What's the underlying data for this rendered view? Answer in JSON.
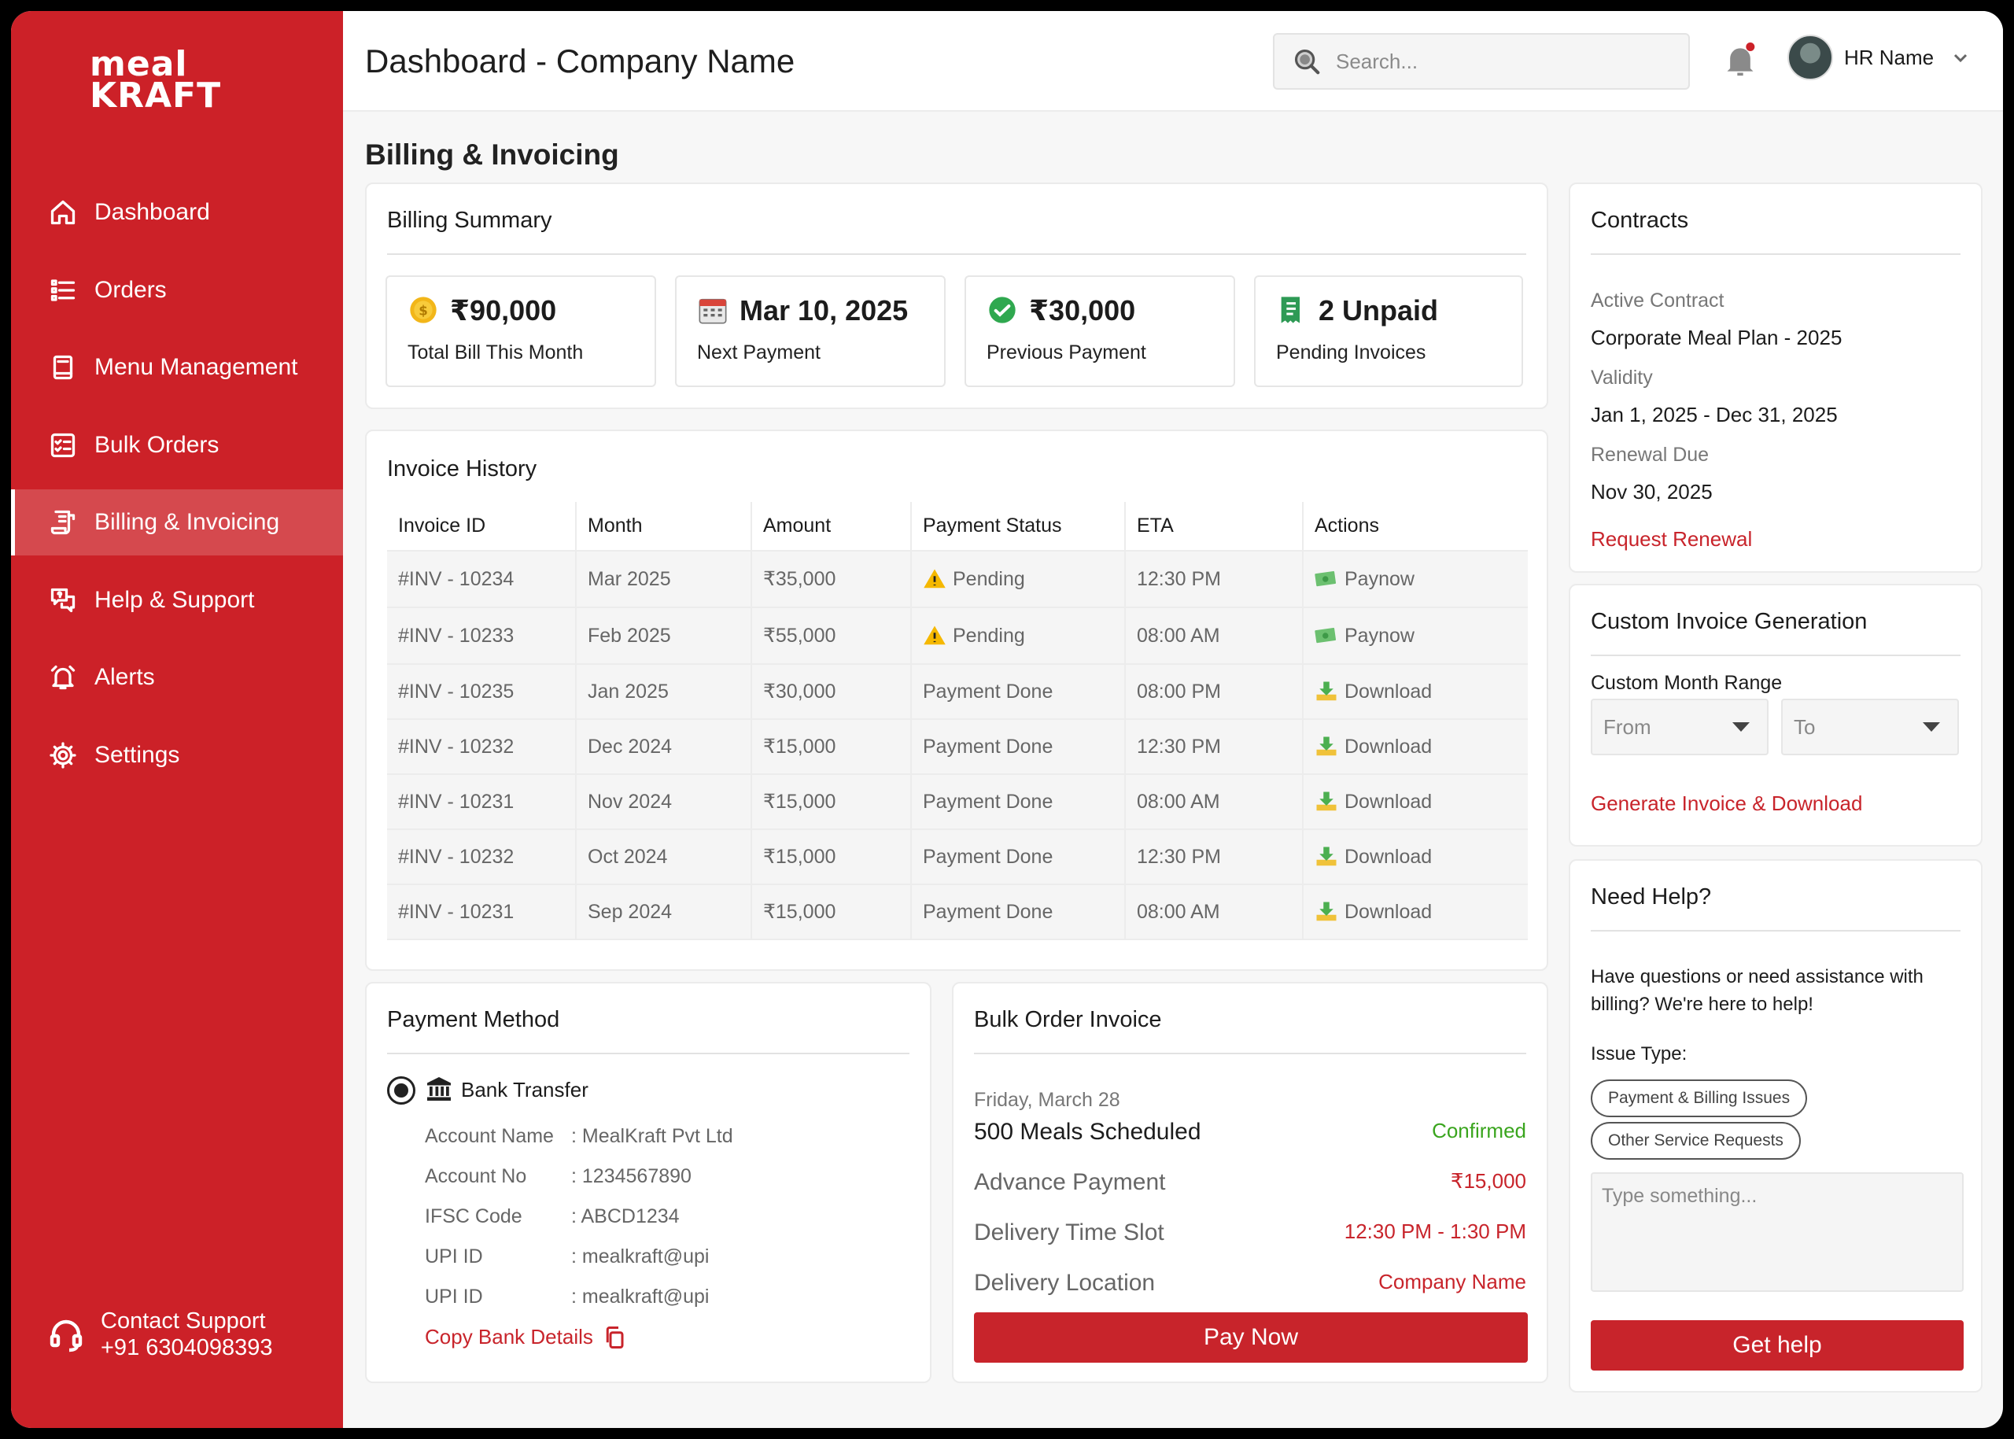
{
  "brand": {
    "logo_line1": "meal",
    "logo_line2": "KRAFT"
  },
  "sidebar": {
    "items": [
      {
        "label": "Dashboard",
        "icon": "home-icon"
      },
      {
        "label": "Orders",
        "icon": "list-icon"
      },
      {
        "label": "Menu Management",
        "icon": "menu-book-icon"
      },
      {
        "label": "Bulk Orders",
        "icon": "checklist-icon"
      },
      {
        "label": "Billing & Invoicing",
        "icon": "invoice-icon",
        "active": true
      },
      {
        "label": "Help & Support",
        "icon": "help-chat-icon"
      },
      {
        "label": "Alerts",
        "icon": "alarm-icon"
      },
      {
        "label": "Settings",
        "icon": "gear-icon"
      }
    ],
    "support": {
      "title": "Contact Support",
      "phone": "+91 6304098393"
    }
  },
  "header": {
    "title": "Dashboard - Company Name",
    "search_placeholder": "Search...",
    "user_name": "HR Name"
  },
  "section_title": "Billing & Invoicing",
  "billing_summary": {
    "title": "Billing Summary",
    "stats": [
      {
        "value": "₹90,000",
        "label": "Total Bill This Month",
        "icon": "coin-icon"
      },
      {
        "value": "Mar 10, 2025",
        "label": "Next Payment",
        "icon": "calendar-icon"
      },
      {
        "value": "₹30,000",
        "label": "Previous Payment",
        "icon": "check-badge-icon"
      },
      {
        "value": "2 Unpaid",
        "label": "Pending Invoices",
        "icon": "receipt-icon"
      }
    ]
  },
  "invoice_history": {
    "title": "Invoice History",
    "columns": [
      "Invoice ID",
      "Month",
      "Amount",
      "Payment Status",
      "ETA",
      "Actions"
    ],
    "rows": [
      {
        "id": "#INV - 10234",
        "month": "Mar 2025",
        "amount": "₹35,000",
        "status": "Pending",
        "eta": "12:30 PM",
        "action": "Paynow"
      },
      {
        "id": "#INV - 10233",
        "month": "Feb 2025",
        "amount": "₹55,000",
        "status": "Pending",
        "eta": "08:00 AM",
        "action": "Paynow"
      },
      {
        "id": "#INV - 10235",
        "month": "Jan 2025",
        "amount": "₹30,000",
        "status": "Payment Done",
        "eta": "08:00 PM",
        "action": "Download"
      },
      {
        "id": "#INV - 10232",
        "month": "Dec 2024",
        "amount": "₹15,000",
        "status": "Payment Done",
        "eta": "12:30 PM",
        "action": "Download"
      },
      {
        "id": "#INV - 10231",
        "month": "Nov 2024",
        "amount": "₹15,000",
        "status": "Payment Done",
        "eta": "08:00 AM",
        "action": "Download"
      },
      {
        "id": "#INV - 10232",
        "month": "Oct 2024",
        "amount": "₹15,000",
        "status": "Payment Done",
        "eta": "12:30 PM",
        "action": "Download"
      },
      {
        "id": "#INV - 10231",
        "month": "Sep 2024",
        "amount": "₹15,000",
        "status": "Payment Done",
        "eta": "08:00 AM",
        "action": "Download"
      }
    ]
  },
  "payment_method": {
    "title": "Payment Method",
    "option": "Bank Transfer",
    "details": [
      {
        "key": "Account Name",
        "value": ": MealKraft Pvt Ltd"
      },
      {
        "key": "Account No",
        "value": ": 1234567890"
      },
      {
        "key": "IFSC Code",
        "value": ": ABCD1234"
      },
      {
        "key": "UPI ID",
        "value": ": mealkraft@upi"
      },
      {
        "key": "UPI ID",
        "value": ": mealkraft@upi"
      }
    ],
    "copy_label": "Copy Bank Details"
  },
  "bulk_invoice": {
    "title": "Bulk Order Invoice",
    "date": "Friday, March 28",
    "meals": "500 Meals Scheduled",
    "status": "Confirmed",
    "advance_label": "Advance Payment",
    "advance_value": "₹15,000",
    "slot_label": "Delivery Time Slot",
    "slot_value": "12:30 PM - 1:30 PM",
    "location_label": "Delivery Location",
    "location_value": "Company Name",
    "pay_button": "Pay Now"
  },
  "contracts": {
    "title": "Contracts",
    "active_label": "Active Contract",
    "active_value": "Corporate Meal Plan - 2025",
    "validity_label": "Validity",
    "validity_value": "Jan 1, 2025 - Dec 31, 2025",
    "renewal_label": "Renewal Due",
    "renewal_value": "Nov 30, 2025",
    "renewal_link": "Request Renewal"
  },
  "custom_invoice": {
    "title": "Custom Invoice Generation",
    "range_label": "Custom Month Range",
    "from": "From",
    "to": "To",
    "generate_link": "Generate Invoice & Download"
  },
  "help": {
    "title": "Need Help?",
    "text": "Have questions or need assistance with billing? We're here to help!",
    "issue_label": "Issue Type:",
    "chips": [
      "Payment & Billing Issues",
      "Other Service Requests"
    ],
    "textarea_placeholder": "Type something...",
    "button": "Get help"
  },
  "colors": {
    "brand_red": "#cc2128",
    "accent_red": "#c8242b",
    "confirmed_green": "#3aa51e"
  }
}
